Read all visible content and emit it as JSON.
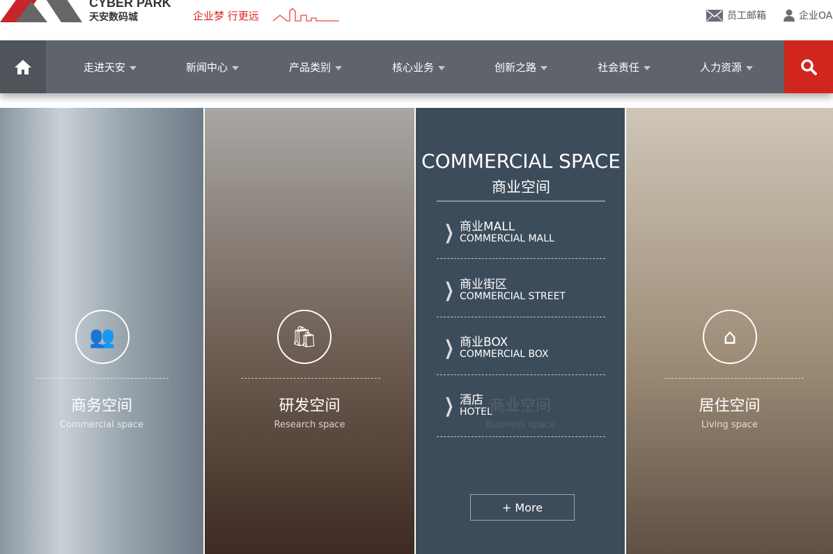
{
  "header": {
    "brand_en": "CYBER PARK",
    "brand_cn": "天安数码城",
    "slogan": "企业梦 行更远",
    "links": [
      {
        "label": "员工邮箱",
        "icon": "mail-icon"
      },
      {
        "label": "企业OA",
        "icon": "user-icon"
      }
    ]
  },
  "nav": {
    "items": [
      "走进天安",
      "新闻中心",
      "产品类别",
      "核心业务",
      "创新之路",
      "社会责任",
      "人力资源"
    ]
  },
  "panels": [
    {
      "title": "商务空间",
      "subtitle": "Commercial space",
      "icon": "people-icon"
    },
    {
      "title": "研发空间",
      "subtitle": "Research space",
      "icon": "bag-icon"
    },
    {
      "title": "商业空间",
      "subtitle": "Business space"
    },
    {
      "title": "居住空间",
      "subtitle": "Living space",
      "icon": "house-icon"
    }
  ],
  "commercial": {
    "title_en": "COMMERCIAL SPACE",
    "title_cn": "商业空间",
    "items": [
      {
        "cn": "商业MALL",
        "en": "COMMERCIAL MALL"
      },
      {
        "cn": "商业街区",
        "en": "COMMERCIAL STREET"
      },
      {
        "cn": "商业BOX",
        "en": "COMMERCIAL BOX"
      },
      {
        "cn": "酒店",
        "en": "HOTEL"
      }
    ],
    "more": "+ More"
  },
  "colors": {
    "accent": "#d0261d",
    "nav": "#5f636c",
    "overlay": "#3d4c5b"
  }
}
